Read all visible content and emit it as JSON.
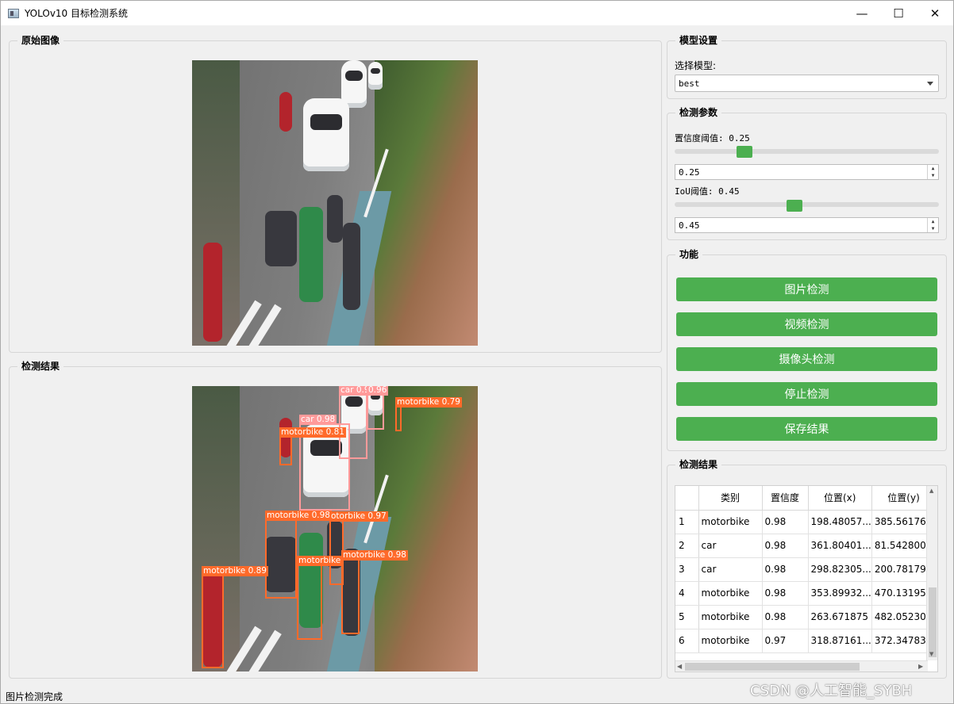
{
  "window": {
    "title": "YOLOv10 目标检测系统",
    "icon": "app-icon",
    "controls": {
      "minimize": "—",
      "maximize": "☐",
      "close": "✕"
    }
  },
  "original_panel": {
    "title": "原始图像"
  },
  "result_panel": {
    "title": "检测结果",
    "detections": [
      {
        "label": "car 0.98"
      },
      {
        "label": "0.96"
      },
      {
        "label": "motorbike 0.79"
      },
      {
        "label": "car 0.98"
      },
      {
        "label": "motorbike 0.81"
      },
      {
        "label": "motorbike 0.98"
      },
      {
        "label": "otorbike 0.97"
      },
      {
        "label": "motorbike 0.98"
      },
      {
        "label": "motorbike"
      },
      {
        "label": "motorbike 0.89"
      }
    ]
  },
  "model_settings": {
    "title": "模型设置",
    "select_label": "选择模型:",
    "selected_model": "best"
  },
  "detection_params": {
    "title": "检测参数",
    "confidence_label": "置信度阈值: 0.25",
    "confidence_value": "0.25",
    "confidence_fraction": 0.25,
    "iou_label": "IoU阈值: 0.45",
    "iou_value": "0.45",
    "iou_fraction": 0.45
  },
  "functions": {
    "title": "功能",
    "buttons": [
      "图片检测",
      "视频检测",
      "摄像头检测",
      "停止检测",
      "保存结果"
    ],
    "button_color": "#4caf50"
  },
  "results_table": {
    "title": "检测结果",
    "headers": [
      "类别",
      "置信度",
      "位置(x)",
      "位置(y)"
    ],
    "rows": [
      {
        "num": "1",
        "cls": "motorbike",
        "conf": "0.98",
        "x": "198.48057...",
        "y": "385.56176..."
      },
      {
        "num": "2",
        "cls": "car",
        "conf": "0.98",
        "x": "361.80401...",
        "y": "81.542800..."
      },
      {
        "num": "3",
        "cls": "car",
        "conf": "0.98",
        "x": "298.82305...",
        "y": "200.78179..."
      },
      {
        "num": "4",
        "cls": "motorbike",
        "conf": "0.98",
        "x": "353.89932...",
        "y": "470.13195..."
      },
      {
        "num": "5",
        "cls": "motorbike",
        "conf": "0.98",
        "x": "263.671875",
        "y": "482.05230..."
      },
      {
        "num": "6",
        "cls": "motorbike",
        "conf": "0.97",
        "x": "318.87161...",
        "y": "372.34783..."
      }
    ]
  },
  "status": {
    "text": "图片检测完成"
  },
  "watermark": "CSDN @人工智能_SYBH"
}
